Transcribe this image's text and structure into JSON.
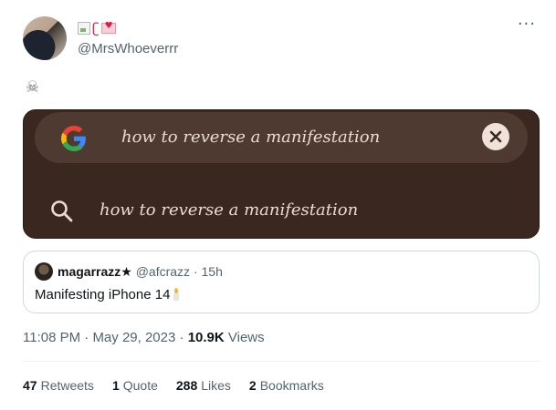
{
  "tweet": {
    "handle": "@MrsWhoeverrr",
    "text_icon": "skull-emoji",
    "more_icon": "ellipsis-icon",
    "name_icons": [
      "broken-image-icon",
      "snake-emoji",
      "love-letter-emoji"
    ]
  },
  "media": {
    "search_query": "how to reverse a manifestation",
    "suggestion": "how to reverse a manifestation",
    "colors": {
      "background": "#3a2720",
      "search_bar": "#4e3a30",
      "text": "#eadbd0",
      "clear_button": "#f1e2d9"
    },
    "icons": {
      "logo": "google-logo",
      "clear": "close-icon",
      "suggestion": "search-icon"
    }
  },
  "quote": {
    "name": "magarrazz★",
    "handle": "@afcrazz",
    "separator": "·",
    "time": "15h",
    "text": "Manifesting iPhone 14",
    "text_emoji": "candle-emoji"
  },
  "meta": {
    "time": "11:08 PM",
    "sep1": "·",
    "date": "May 29, 2023",
    "sep2": "·",
    "views_count": "10.9K",
    "views_label": "Views"
  },
  "stats": [
    {
      "count": "47",
      "label": "Retweets"
    },
    {
      "count": "1",
      "label": "Quote"
    },
    {
      "count": "288",
      "label": "Likes"
    },
    {
      "count": "2",
      "label": "Bookmarks"
    }
  ]
}
